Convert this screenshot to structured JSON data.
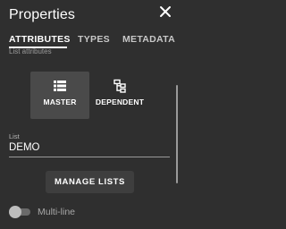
{
  "header": {
    "title": "Properties",
    "close_icon": "close-icon"
  },
  "tabs": [
    {
      "label": "ATTRIBUTES",
      "active": true
    },
    {
      "label": "TYPES",
      "active": false
    },
    {
      "label": "METADATA",
      "active": false
    }
  ],
  "section": {
    "partial_label": "List attributes"
  },
  "types": [
    {
      "label": "MASTER",
      "icon": "list-icon",
      "selected": true
    },
    {
      "label": "DEPENDENT",
      "icon": "hierarchy-icon",
      "selected": false
    }
  ],
  "list_field": {
    "label": "List",
    "value": "DEMO"
  },
  "manage_button": {
    "label": "MANAGE LISTS"
  },
  "multiline_toggle": {
    "label": "Multi-line",
    "checked": false
  },
  "colors": {
    "background": "#2f2f2f",
    "selected_tile": "#4a4a4a",
    "button": "#3e3e3e",
    "text": "#ffffff",
    "muted": "#9a9a9a"
  }
}
